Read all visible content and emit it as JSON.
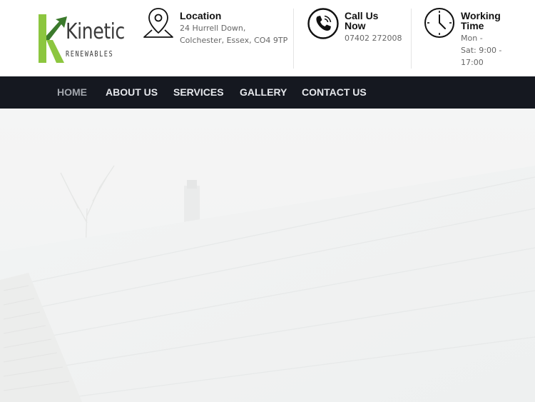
{
  "brand": {
    "name": "Kinetic",
    "tagline": "RENEWABLES",
    "colors": {
      "accent_green": "#8cc63f",
      "dark_green": "#3b7a2c",
      "text": "#3a3a3a"
    }
  },
  "contact_blocks": [
    {
      "icon": "location-pin-icon",
      "title": "Location",
      "lines": [
        "24 Hurrell Down,",
        "Colchester, Essex, CO4 9TP"
      ]
    },
    {
      "icon": "phone-icon",
      "title_lines": [
        "Call Us",
        "Now"
      ],
      "lines": [
        "07402 272008"
      ]
    },
    {
      "icon": "clock-icon",
      "title_lines": [
        "Working",
        "Time"
      ],
      "lines": [
        "Mon -",
        "Sat: 9:00 -",
        "17:00"
      ]
    }
  ],
  "nav": {
    "items": [
      "HOME",
      "ABOUT US",
      "SERVICES",
      "GALLERY",
      "CONTACT US"
    ],
    "active": "HOME",
    "background": "#151820"
  },
  "hero": {
    "subject": "solar-panel-roof-photo",
    "overlay": "white-fade"
  }
}
